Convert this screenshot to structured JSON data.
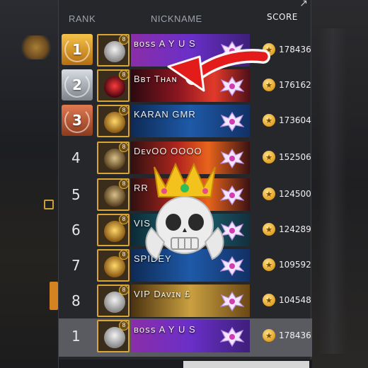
{
  "header": {
    "rank_label": "RANK",
    "nickname_label": "NICKNAME",
    "score_label": "SCORE"
  },
  "rows": [
    {
      "rank": "1",
      "badge": "gold",
      "level": "8",
      "name": "ʙᴏꜱꜱ A Y U S",
      "score": "178436",
      "banner": "purple",
      "avatar": "skull"
    },
    {
      "rank": "2",
      "badge": "silver",
      "level": "8",
      "name": "Bʙᴛ  Tʜᴀɴ",
      "score": "176162",
      "banner": "red",
      "avatar": "demon"
    },
    {
      "rank": "3",
      "badge": "bronze",
      "level": "8",
      "name": "KARAN  GMR",
      "score": "173604",
      "banner": "blue",
      "avatar": "gold"
    },
    {
      "rank": "4",
      "badge": "",
      "level": "8",
      "name": "DᴇᴠOO  OOOO",
      "score": "152506",
      "banner": "fire",
      "avatar": "bird"
    },
    {
      "rank": "5",
      "badge": "",
      "level": "8",
      "name": "RR",
      "score": "124500",
      "banner": "fire",
      "avatar": "bird"
    },
    {
      "rank": "6",
      "badge": "",
      "level": "8",
      "name": "VIS",
      "score": "124289",
      "banner": "teal",
      "avatar": "gold"
    },
    {
      "rank": "7",
      "badge": "",
      "level": "8",
      "name": "SPIDEY",
      "score": "109592",
      "banner": "blue",
      "avatar": "gold"
    },
    {
      "rank": "8",
      "badge": "",
      "level": "8",
      "name": "VIP  Dᴀᴠɪɴ  £",
      "score": "104548",
      "banner": "gold",
      "avatar": "skull"
    }
  ],
  "self_row": {
    "rank": "1",
    "level": "8",
    "name": "ʙᴏꜱꜱ A Y U S",
    "score": "178436",
    "banner": "purple",
    "avatar": "skull"
  },
  "icons": {
    "score": "star-coin-icon",
    "emblem": "winged-emblem-icon",
    "overlay_arrow": "red-arrow-icon",
    "overlay_emoji": "crowned-skull-emoji-icon",
    "header": "share-icon"
  },
  "colors": {
    "panel": "#26272b",
    "self_row": "#5a5b60",
    "header_text": "#9ea2aa",
    "gold": "#f6c34a",
    "arrow": "#e41b1b"
  }
}
